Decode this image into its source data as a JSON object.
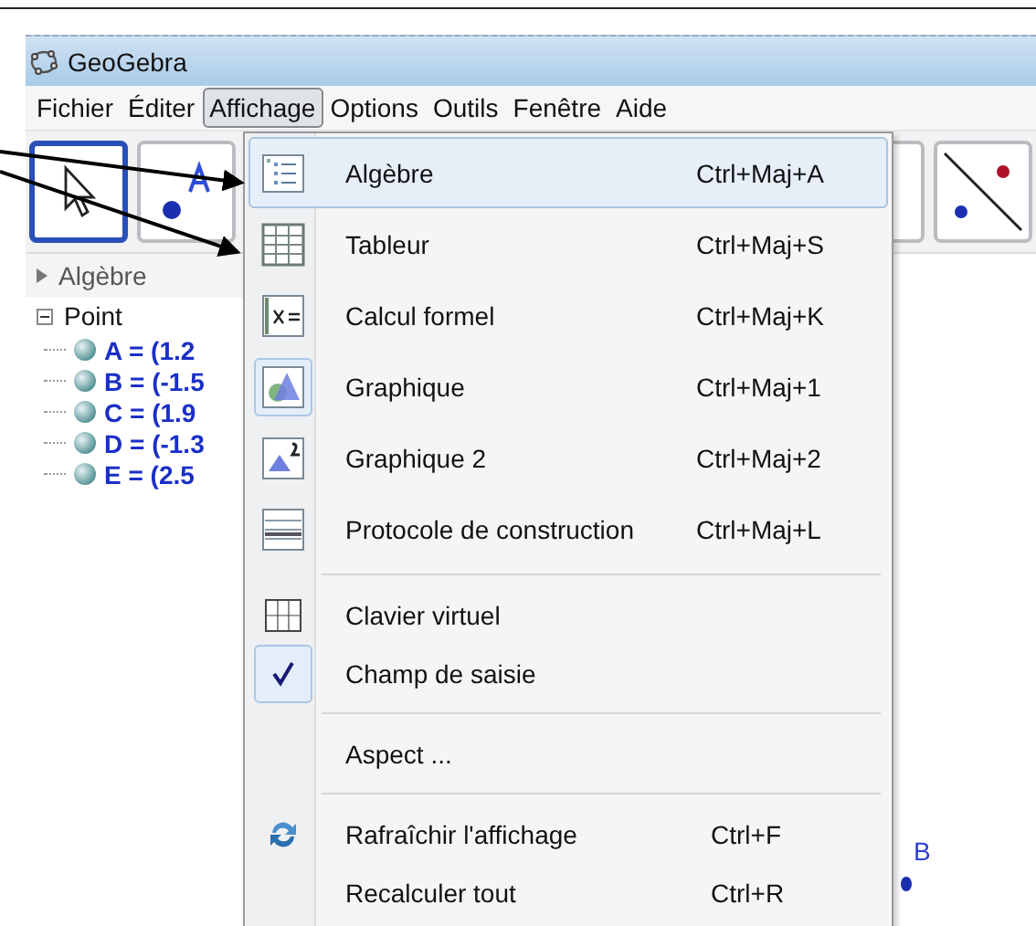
{
  "window": {
    "title": "GeoGebra"
  },
  "menubar": [
    {
      "label": "Fichier",
      "selected": false
    },
    {
      "label": "Éditer",
      "selected": false
    },
    {
      "label": "Affichage",
      "selected": true
    },
    {
      "label": "Options",
      "selected": false
    },
    {
      "label": "Outils",
      "selected": false
    },
    {
      "label": "Fenêtre",
      "selected": false
    },
    {
      "label": "Aide",
      "selected": false
    }
  ],
  "algebra": {
    "header": "Algèbre",
    "tree": [
      {
        "label": "Point",
        "expanded": true,
        "children": [
          {
            "label": "A = (1.2"
          },
          {
            "label": "B = (-1.5"
          },
          {
            "label": "C = (1.9"
          },
          {
            "label": "D = (-1.3"
          },
          {
            "label": "E = (2.5"
          }
        ]
      }
    ]
  },
  "graphics": {
    "point_label": "B"
  },
  "menu": [
    {
      "kind": "item",
      "label": "Algèbre",
      "shortcut": "Ctrl+Maj+A",
      "highlighted": true,
      "checked": false
    },
    {
      "kind": "item",
      "label": "Tableur",
      "shortcut": "Ctrl+Maj+S",
      "highlighted": false,
      "checked": false
    },
    {
      "kind": "item",
      "label": "Calcul formel",
      "shortcut": "Ctrl+Maj+K",
      "highlighted": false,
      "checked": false
    },
    {
      "kind": "item",
      "label": "Graphique",
      "shortcut": "Ctrl+Maj+1",
      "highlighted": false,
      "checked": true
    },
    {
      "kind": "item",
      "label": "Graphique 2",
      "shortcut": "Ctrl+Maj+2",
      "highlighted": false,
      "checked": false
    },
    {
      "kind": "item",
      "label": "Protocole de construction",
      "shortcut": "Ctrl+Maj+L",
      "highlighted": false,
      "checked": false
    },
    {
      "kind": "separator"
    },
    {
      "kind": "item",
      "label": "Clavier virtuel",
      "highlighted": false,
      "checked": false
    },
    {
      "kind": "item",
      "label": "Champ de saisie",
      "highlighted": false,
      "checked": true
    },
    {
      "kind": "separator"
    },
    {
      "kind": "item",
      "label": "Aspect ...",
      "highlighted": false,
      "checked": false
    },
    {
      "kind": "separator"
    },
    {
      "kind": "item",
      "label": "Rafraîchir l'affichage",
      "shortcut": "Ctrl+F",
      "highlighted": false,
      "checked": false
    },
    {
      "kind": "item",
      "label": "Recalculer tout",
      "shortcut": "Ctrl+R",
      "highlighted": false,
      "checked": false
    }
  ]
}
